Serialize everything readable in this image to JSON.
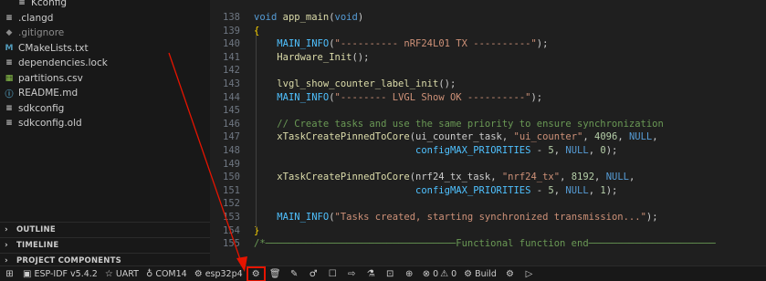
{
  "explorer": {
    "files": [
      {
        "label": "Kconfig",
        "icon": "lines-icon",
        "glyph": "≡",
        "color": "#cccccc"
      },
      {
        "label": ".clangd",
        "icon": "lines-icon",
        "glyph": "≡",
        "color": "#cccccc"
      },
      {
        "label": ".gitignore",
        "icon": "git-icon",
        "glyph": "◆",
        "color": "#8c8c8c"
      },
      {
        "label": "CMakeLists.txt",
        "icon": "cmake-icon",
        "glyph": "M",
        "color": "#519aba"
      },
      {
        "label": "dependencies.lock",
        "icon": "lines-icon",
        "glyph": "≡",
        "color": "#cccccc"
      },
      {
        "label": "partitions.csv",
        "icon": "table-icon",
        "glyph": "▦",
        "color": "#8bc34a"
      },
      {
        "label": "README.md",
        "icon": "info-icon",
        "glyph": "ⓘ",
        "color": "#519aba"
      },
      {
        "label": "sdkconfig",
        "icon": "lines-icon",
        "glyph": "≡",
        "color": "#cccccc"
      },
      {
        "label": "sdkconfig.old",
        "icon": "lines-icon",
        "glyph": "≡",
        "color": "#cccccc"
      }
    ],
    "sections": [
      "OUTLINE",
      "TIMELINE",
      "PROJECT COMPONENTS"
    ]
  },
  "editor": {
    "lines": [
      {
        "num": "138",
        "code": "void app_main(void)"
      },
      {
        "num": "139",
        "code": "{"
      },
      {
        "num": "140",
        "code": "    MAIN_INFO(\"---------- nRF24L01 TX ----------\");"
      },
      {
        "num": "141",
        "code": "    Hardware_Init();"
      },
      {
        "num": "142",
        "code": ""
      },
      {
        "num": "143",
        "code": "    lvgl_show_counter_label_init();"
      },
      {
        "num": "144",
        "code": "    MAIN_INFO(\"-------- LVGL Show OK ----------\");"
      },
      {
        "num": "145",
        "code": ""
      },
      {
        "num": "146",
        "code": "    // Create tasks and use the same priority to ensure synchronization"
      },
      {
        "num": "147",
        "code": "    xTaskCreatePinnedToCore(ui_counter_task, \"ui_counter\", 4096, NULL,"
      },
      {
        "num": "148",
        "code": "                            configMAX_PRIORITIES - 5, NULL, 0);"
      },
      {
        "num": "149",
        "code": ""
      },
      {
        "num": "150",
        "code": "    xTaskCreatePinnedToCore(nrf24_tx_task, \"nrf24_tx\", 8192, NULL,"
      },
      {
        "num": "151",
        "code": "                            configMAX_PRIORITIES - 5, NULL, 1);"
      },
      {
        "num": "152",
        "code": ""
      },
      {
        "num": "153",
        "code": "    MAIN_INFO(\"Tasks created, starting synchronized transmission...\");"
      },
      {
        "num": "154",
        "code": "}"
      },
      {
        "num": "155",
        "code": "/*─────────────────────────────────Functional function end──────────────────────"
      }
    ]
  },
  "statusbar": {
    "left_icons": [
      {
        "name": "remote-icon",
        "glyph": "⊞"
      }
    ],
    "items": [
      {
        "name": "esp-idf-version",
        "sym": "▣",
        "label": "ESP-IDF v5.4.2"
      },
      {
        "name": "uart-flash-method",
        "sym": "☆",
        "label": "UART"
      },
      {
        "name": "serial-port",
        "sym": "♁",
        "label": "COM14"
      },
      {
        "name": "target-chip",
        "sym": "⚙",
        "label": "esp32p4"
      }
    ],
    "icons": [
      {
        "name": "sdk-config-gear-icon",
        "glyph": "⚙",
        "highlight": true
      },
      {
        "name": "trash-icon",
        "glyph": "🗑",
        "highlight": false
      },
      {
        "name": "wrench-icon",
        "glyph": "✎",
        "highlight": false
      },
      {
        "name": "flame-icon",
        "glyph": "♂",
        "highlight": false
      },
      {
        "name": "monitor-icon",
        "glyph": "☐",
        "highlight": false
      },
      {
        "name": "flash-icon",
        "glyph": "⇨",
        "highlight": false
      },
      {
        "name": "flask-icon",
        "glyph": "⚗",
        "highlight": false
      },
      {
        "name": "terminal-icon",
        "glyph": "⊡",
        "highlight": false
      },
      {
        "name": "import-icon",
        "glyph": "⊕",
        "highlight": false
      }
    ],
    "problems": {
      "errors": "0",
      "warnings": "0"
    },
    "build_label": "Build",
    "extra_icons": [
      {
        "name": "debug-icon",
        "glyph": "⚙"
      },
      {
        "name": "run-icon",
        "glyph": "▷"
      }
    ]
  },
  "colors": {
    "annotation": "#e51400"
  }
}
